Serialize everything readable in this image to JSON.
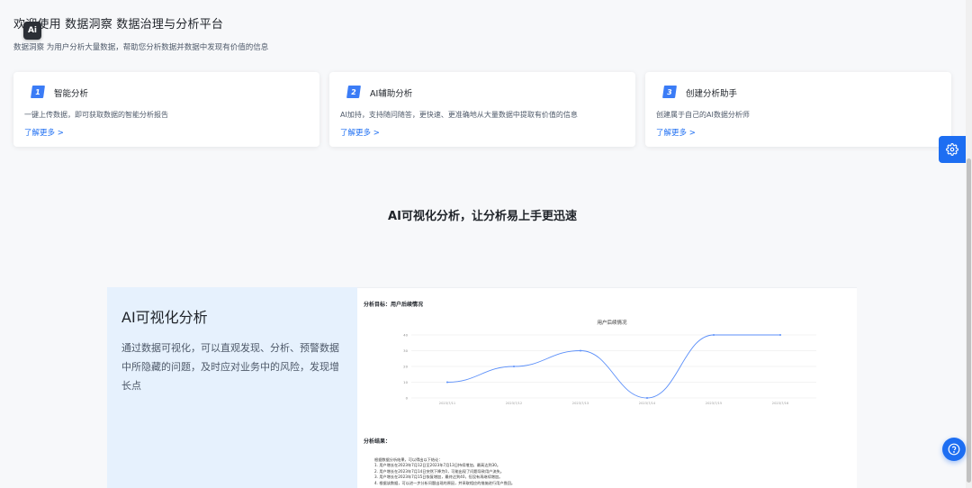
{
  "header": {
    "title": "欢迎使用 数据洞察 数据治理与分析平台",
    "subtitle": "数据洞察 为用户分析大量数据，帮助您分析数据并数据中发现有价值的信息",
    "badge": "Ai"
  },
  "cards": [
    {
      "num": "1",
      "title": "智能分析",
      "desc": "一键上传数据，即可获取数据的智能分析报告",
      "more": "了解更多 >"
    },
    {
      "num": "2",
      "title": "AI辅助分析",
      "desc": "AI加持，支持随问随答，更快速、更准确地从大量数据中提取有价值的信息",
      "more": "了解更多 >"
    },
    {
      "num": "3",
      "title": "创建分析助手",
      "desc": "创建属于自己的AI数据分析师",
      "more": "了解更多 >"
    }
  ],
  "section": {
    "title": "AI可视化分析，让分析易上手更迅速"
  },
  "feature": {
    "title": "AI可视化分析",
    "desc": "通过数据可视化，可以直观发现、分析、预警数据中所隐藏的问题，及时应对业务中的风险，发现增长点"
  },
  "analysis": {
    "goal": "分析目标：用户后续情况",
    "result_label": "分析结果：",
    "result_lines": [
      "根据数据分析结果，可以得出以下结论：",
      "1. 用户增长在2023年7月12日至2023年7月13日持续增加，最高达到30。",
      "2. 用户增长在2023年7月14日突然下降为0，可能出现了问题导致用户流失。",
      "3. 用户增长在2023年7月15日恢复增加，最终达到40，但没有再继续增加。",
      "4. 根据该数据，可以进一步分析问题出现的原因，并采取相应的措施进行用户挽回。"
    ]
  },
  "chart_data": {
    "type": "line",
    "title": "用户后续情况",
    "categories": [
      "2023/7/11",
      "2023/7/12",
      "2023/7/13",
      "2023/7/14",
      "2023/7/15",
      "2023/7/16"
    ],
    "series": [
      {
        "values": [
          10,
          20,
          30,
          0,
          40,
          40
        ]
      }
    ],
    "yticks": [
      "0",
      "10",
      "20",
      "30",
      "40"
    ],
    "ylim": [
      0,
      40
    ],
    "grid": true,
    "color": "#5b8ff9"
  },
  "icons": {
    "settings": "gear-icon",
    "help": "question-icon"
  },
  "colors": {
    "accent": "#1d6ef2",
    "feature_bg": "#e6f1fd"
  }
}
